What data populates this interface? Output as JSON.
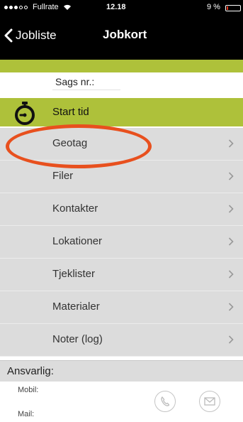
{
  "status_bar": {
    "carrier": "Fullrate",
    "time": "12.18",
    "battery": "9 %",
    "battery_level": 0.09
  },
  "nav": {
    "back_label": "Jobliste",
    "title": "Jobkort"
  },
  "sags_field": {
    "label": "Sags nr.:"
  },
  "start_time": {
    "label": "Start tid",
    "icon": "stopwatch-icon"
  },
  "menu": [
    {
      "label": "Geotag"
    },
    {
      "label": "Filer"
    },
    {
      "label": "Kontakter"
    },
    {
      "label": "Lokationer"
    },
    {
      "label": "Tjeklister"
    },
    {
      "label": "Materialer"
    },
    {
      "label": "Noter (log)"
    }
  ],
  "responsible": {
    "label": "Ansvarlig:",
    "mobile_label": "Mobil:",
    "mail_label": "Mail:"
  },
  "colors": {
    "accent_green": "#aec13a",
    "highlight_orange": "#e8501e",
    "menu_bg": "#dcdcdc"
  }
}
